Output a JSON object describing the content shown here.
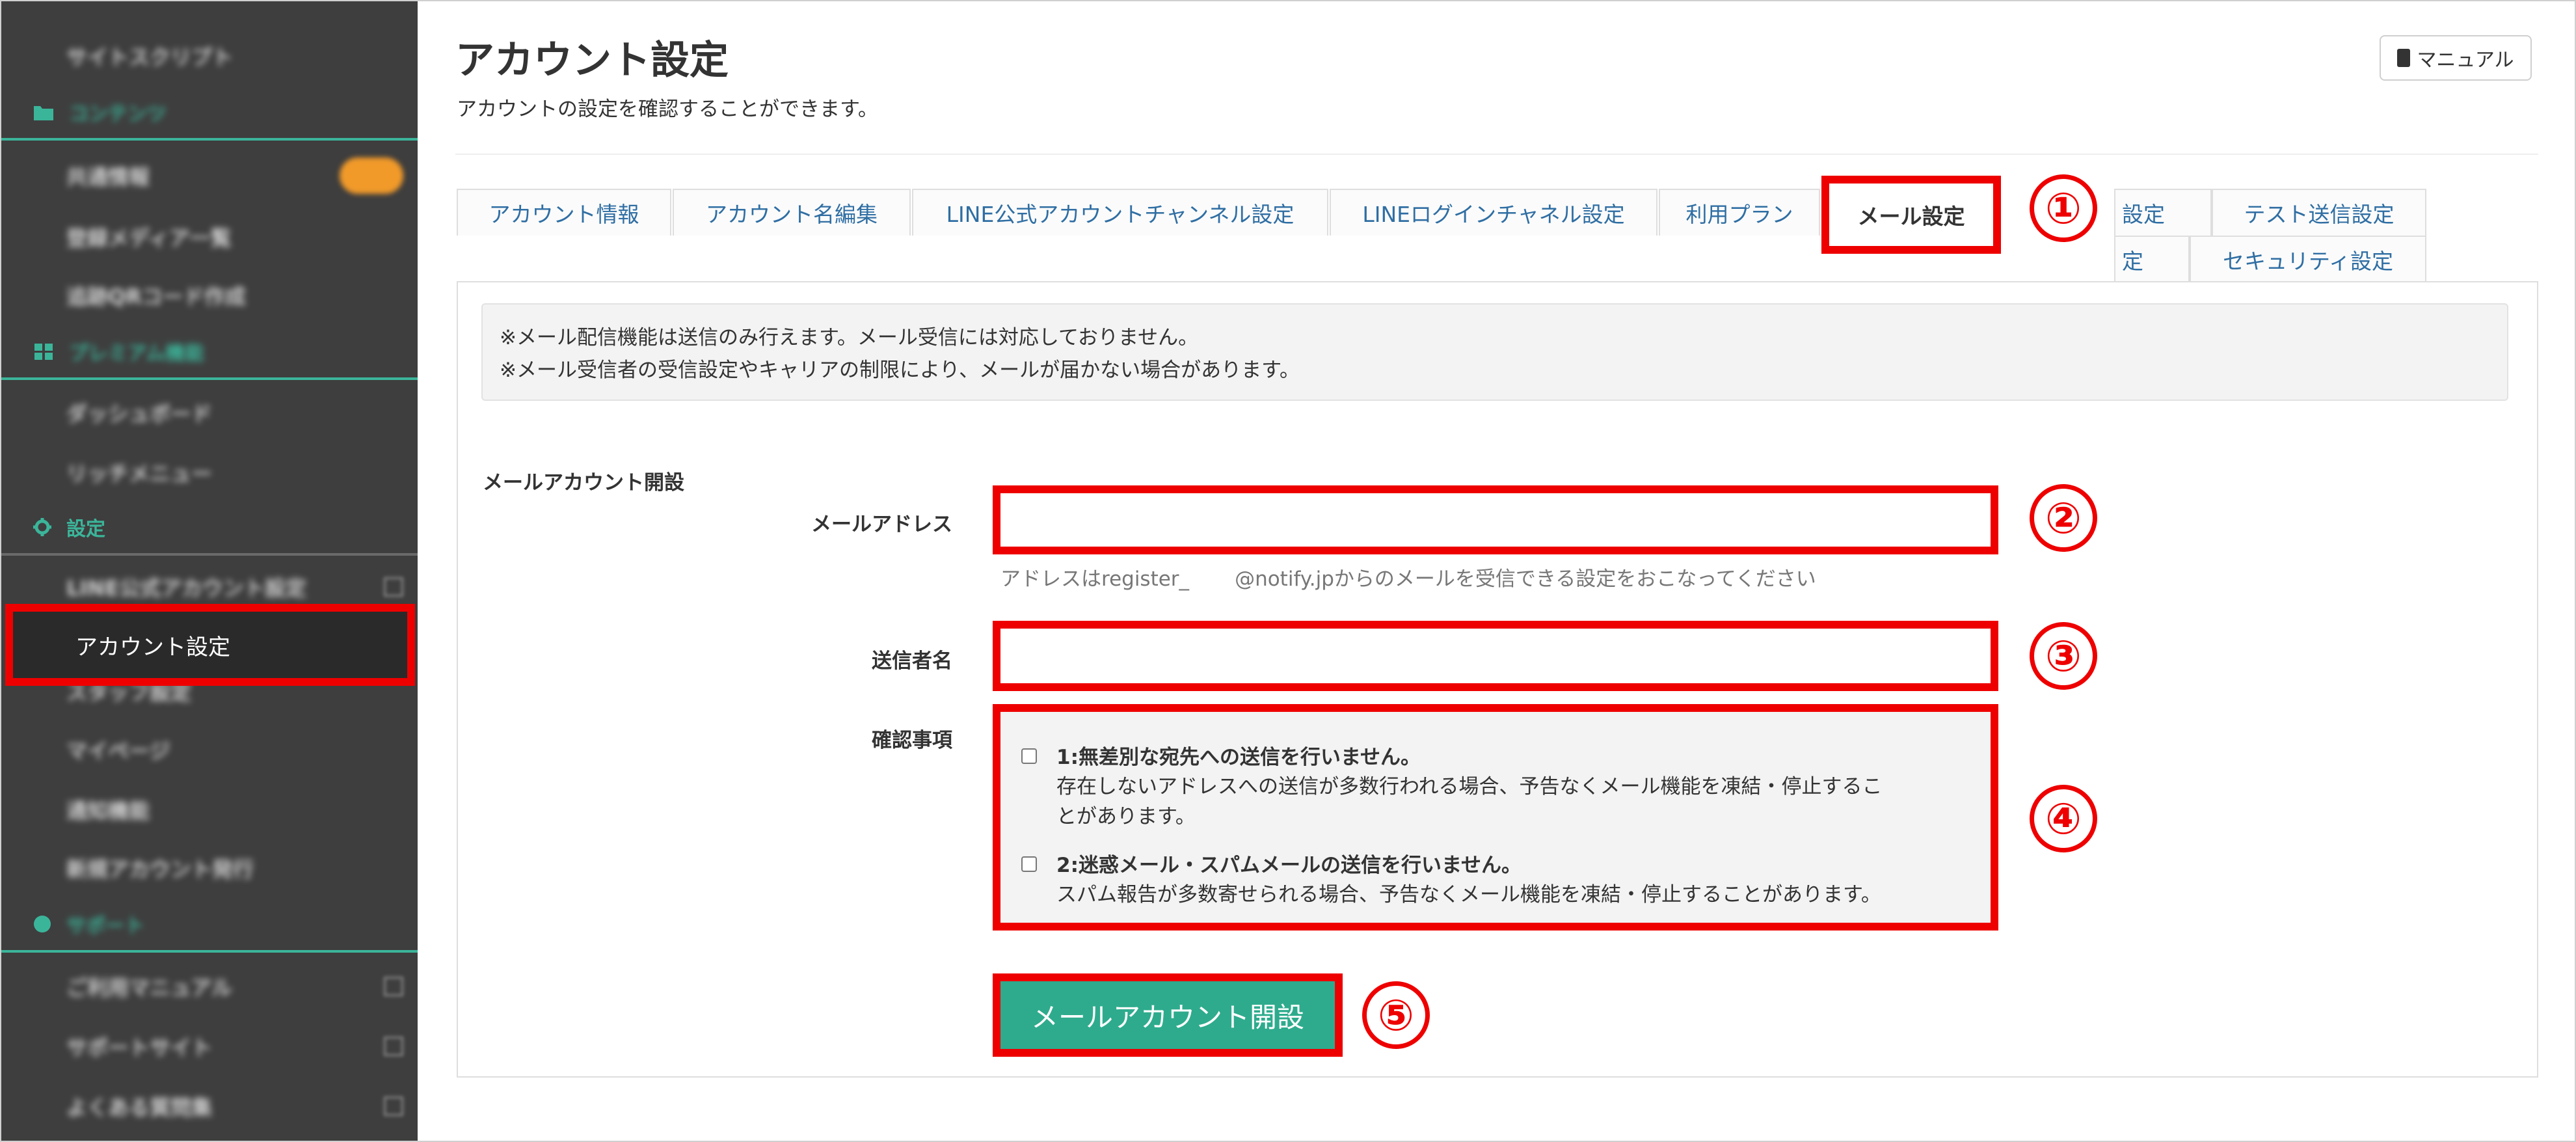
{
  "page": {
    "title": "アカウント設定",
    "subtitle": "アカウントの設定を確認することができます。",
    "manual_label": "マニュアル"
  },
  "sidebar": {
    "items": [
      {
        "label": "サイトスクリプト"
      },
      {
        "label": "コンテンツ",
        "section": true
      },
      {
        "label": "共通情報",
        "badge": "NEW"
      },
      {
        "label": "登録メディア一覧"
      },
      {
        "label": "追跡QRコード作成"
      },
      {
        "label": "プレミアム機能",
        "section": true
      },
      {
        "label": "ダッシュボード"
      },
      {
        "label": "リッチメニュー"
      },
      {
        "label": "設定",
        "section": true
      },
      {
        "label": "LINE公式アカウント設定"
      },
      {
        "label": "アカウント設定",
        "active": true
      },
      {
        "label": "スタッフ設定"
      },
      {
        "label": "マイページ"
      },
      {
        "label": "通知機能"
      },
      {
        "label": "新規アカウント発行"
      },
      {
        "label": "サポート",
        "section": true
      },
      {
        "label": "ご利用マニュアル"
      },
      {
        "label": "サポートサイト"
      },
      {
        "label": "よくある質問集"
      }
    ]
  },
  "tabs": [
    {
      "label": "アカウント情報"
    },
    {
      "label": "アカウント名編集"
    },
    {
      "label": "LINE公式アカウントチャンネル設定"
    },
    {
      "label": "LINEログインチャネル設定"
    },
    {
      "label": "利用プラン"
    },
    {
      "label": "メール設定",
      "active": true
    },
    {
      "label": "設定"
    },
    {
      "label": "テスト送信設定"
    },
    {
      "label": "定"
    },
    {
      "label": "セキュリティ設定"
    }
  ],
  "notice": {
    "line1": "※メール配信機能は送信のみ行えます。メール受信には対応しておりません。",
    "line2": "※メール受信者の受信設定やキャリアの制限により、メールが届かない場合があります。"
  },
  "form": {
    "section_label": "メールアカウント開設",
    "email_label": "メールアドレス",
    "email_value": "",
    "hint_prefix": "アドレスはregister_",
    "hint_suffix": "@notify.jpからのメールを受信できる設定をおこなってください",
    "sender_label": "送信者名",
    "sender_value": "",
    "confirm_label": "確認事項",
    "confirm1_title": "1:無差別な宛先への送信を行いません。",
    "confirm1_desc_a": "存在しないアドレスへの送信が多数行われる場合、予告なくメール機能を凍結・停止するこ",
    "confirm1_desc_b": "とがあります。",
    "confirm2_title": "2:迷惑メール・スパムメールの送信を行いません。",
    "confirm2_desc": "スパム報告が多数寄せられる場合、予告なくメール機能を凍結・停止することがあります。",
    "submit_label": "メールアカウント開設"
  },
  "markers": [
    "①",
    "②",
    "③",
    "④",
    "⑤"
  ],
  "colors": {
    "highlight": "#ee0000",
    "primary": "#2eab8d",
    "sidebar_bg": "#3e3e3e",
    "section_green": "#3bb59a",
    "tab_link": "#2f6ea3",
    "badge": "#f19a2a"
  }
}
